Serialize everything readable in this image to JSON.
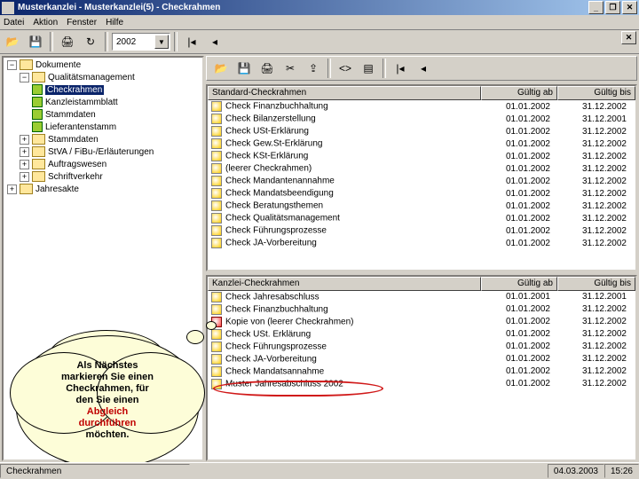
{
  "window": {
    "title": "Musterkanzlei - Musterkanzlei(5) - Checkrahmen"
  },
  "menu": {
    "datei": "Datei",
    "aktion": "Aktion",
    "fenster": "Fenster",
    "hilfe": "Hilfe"
  },
  "toolbar": {
    "year": "2002",
    "icons": [
      "folder-open-icon",
      "save-icon",
      "print-icon",
      "refresh-icon",
      "year-combo",
      "first-icon",
      "prev-icon"
    ]
  },
  "tree": {
    "root": "Dokumente",
    "n1": "Qualitätsmanagement",
    "n1a": "Checkrahmen",
    "n1b": "Kanzleistammblatt",
    "n1c": "Stammdaten",
    "n1d": "Lieferantenstamm",
    "n2": "Stammdaten",
    "n3": "StVA / FiBu-/Erläuterungen",
    "n4": "Auftragswesen",
    "n5": "Schriftverkehr",
    "n6": "Jahresakte"
  },
  "rtb": [
    "open",
    "save",
    "print",
    "export",
    "copy",
    "code1",
    "code2",
    "first",
    "prev"
  ],
  "list1": {
    "h0": "Standard-Checkrahmen",
    "h1": "Gültig ab",
    "h2": "Gültig bis",
    "rows": [
      {
        "t": "Check Finanzbuchhaltung",
        "a": "01.01.2002",
        "b": "31.12.2002"
      },
      {
        "t": "Check Bilanzerstellung",
        "a": "01.01.2002",
        "b": "31.12.2001"
      },
      {
        "t": "Check USt-Erklärung",
        "a": "01.01.2002",
        "b": "31.12.2002"
      },
      {
        "t": "Check Gew.St-Erklärung",
        "a": "01.01.2002",
        "b": "31.12.2002"
      },
      {
        "t": "Check KSt-Erklärung",
        "a": "01.01.2002",
        "b": "31.12.2002"
      },
      {
        "t": "(leerer Checkrahmen)",
        "a": "01.01.2002",
        "b": "31.12.2002"
      },
      {
        "t": "Check Mandantenannahme",
        "a": "01.01.2002",
        "b": "31.12.2002"
      },
      {
        "t": "Check Mandatsbeendigung",
        "a": "01.01.2002",
        "b": "31.12.2002"
      },
      {
        "t": "Check Beratungsthemen",
        "a": "01.01.2002",
        "b": "31.12.2002"
      },
      {
        "t": "Check Qualitätsmanagement",
        "a": "01.01.2002",
        "b": "31.12.2002"
      },
      {
        "t": "Check Führungsprozesse",
        "a": "01.01.2002",
        "b": "31.12.2002"
      },
      {
        "t": "Check JA-Vorbereitung",
        "a": "01.01.2002",
        "b": "31.12.2002"
      }
    ]
  },
  "list2": {
    "h0": "Kanzlei-Checkrahmen",
    "h1": "Gültig ab",
    "h2": "Gültig bis",
    "rows": [
      {
        "t": "Check Jahresabschluss",
        "a": "01.01.2001",
        "b": "31.12.2001"
      },
      {
        "t": "Check Finanzbuchhaltung",
        "a": "01.01.2002",
        "b": "31.12.2002"
      },
      {
        "t": "Kopie von (leerer Checkrahmen)",
        "a": "01.01.2002",
        "b": "31.12.2002",
        "r": true
      },
      {
        "t": "Check USt. Erklärung",
        "a": "01.01.2002",
        "b": "31.12.2002"
      },
      {
        "t": "Check Führungsprozesse",
        "a": "01.01.2002",
        "b": "31.12.2002"
      },
      {
        "t": "Check JA-Vorbereitung",
        "a": "01.01.2002",
        "b": "31.12.2002"
      },
      {
        "t": "Check Mandatsannahme",
        "a": "01.01.2002",
        "b": "31.12.2002"
      },
      {
        "t": "Muster Jahresabschluss 2002",
        "a": "01.01.2002",
        "b": "31.12.2002",
        "hl": true
      }
    ]
  },
  "callout": {
    "l1": "Als Nächstes",
    "l2": "markieren Sie einen",
    "l3": "Checkrahmen, für",
    "l4": "den Sie einen",
    "l5": "Abgleich",
    "l6": "durchführen",
    "l7": "möchten."
  },
  "status": {
    "left": "Checkrahmen",
    "date": "04.03.2003",
    "time": "15:26"
  }
}
